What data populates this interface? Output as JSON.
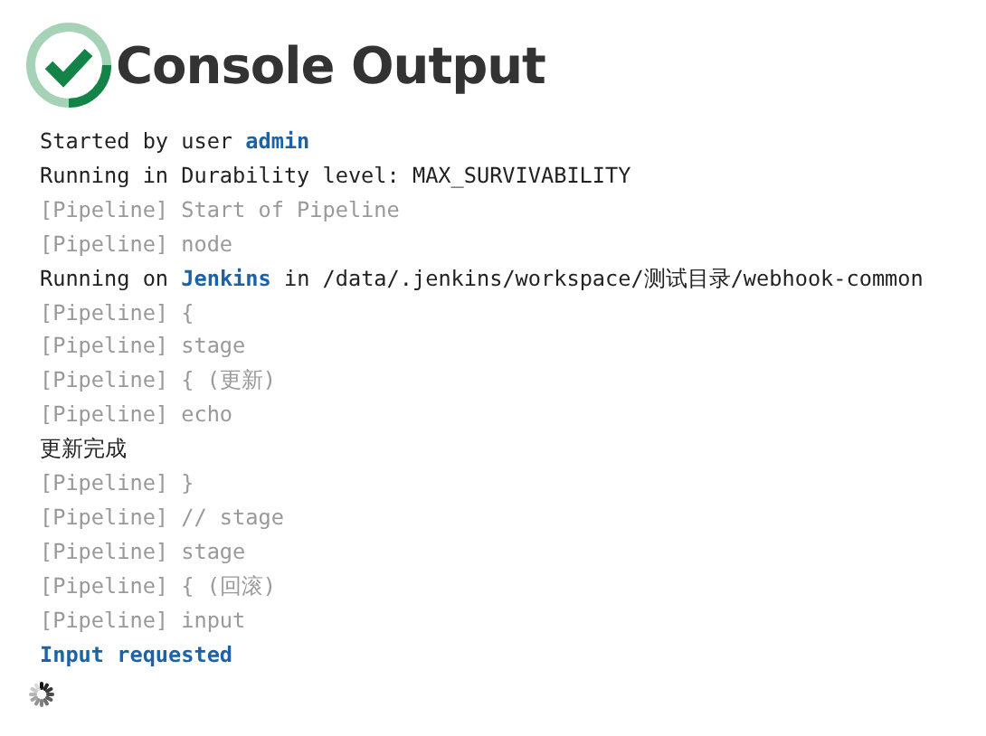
{
  "title": "Console Output",
  "lines": [
    {
      "kind": "plain",
      "parts": [
        {
          "text": "Started by user ",
          "link": false
        },
        {
          "text": "admin",
          "link": true
        }
      ]
    },
    {
      "kind": "plain",
      "parts": [
        {
          "text": "Running in Durability level: MAX_SURVIVABILITY",
          "link": false
        }
      ]
    },
    {
      "kind": "pipeline",
      "parts": [
        {
          "text": "[Pipeline] Start of Pipeline",
          "link": false
        }
      ]
    },
    {
      "kind": "pipeline",
      "parts": [
        {
          "text": "[Pipeline] node",
          "link": false
        }
      ]
    },
    {
      "kind": "plain",
      "parts": [
        {
          "text": "Running on ",
          "link": false
        },
        {
          "text": "Jenkins",
          "link": true
        },
        {
          "text": " in /data/.jenkins/workspace/测试目录/webhook-common",
          "link": false
        }
      ]
    },
    {
      "kind": "pipeline",
      "parts": [
        {
          "text": "[Pipeline] {",
          "link": false
        }
      ]
    },
    {
      "kind": "pipeline",
      "parts": [
        {
          "text": "[Pipeline] stage",
          "link": false
        }
      ]
    },
    {
      "kind": "pipeline",
      "parts": [
        {
          "text": "[Pipeline] { (更新)",
          "link": false
        }
      ]
    },
    {
      "kind": "pipeline",
      "parts": [
        {
          "text": "[Pipeline] echo",
          "link": false
        }
      ]
    },
    {
      "kind": "plain",
      "parts": [
        {
          "text": "更新完成",
          "link": false
        }
      ]
    },
    {
      "kind": "pipeline",
      "parts": [
        {
          "text": "[Pipeline] }",
          "link": false
        }
      ]
    },
    {
      "kind": "pipeline",
      "parts": [
        {
          "text": "[Pipeline] // stage",
          "link": false
        }
      ]
    },
    {
      "kind": "pipeline",
      "parts": [
        {
          "text": "[Pipeline] stage",
          "link": false
        }
      ]
    },
    {
      "kind": "pipeline",
      "parts": [
        {
          "text": "[Pipeline] { (回滚)",
          "link": false
        }
      ]
    },
    {
      "kind": "pipeline",
      "parts": [
        {
          "text": "[Pipeline] input",
          "link": false
        }
      ]
    },
    {
      "kind": "link",
      "parts": [
        {
          "text": "Input requested",
          "link": true
        }
      ]
    }
  ]
}
